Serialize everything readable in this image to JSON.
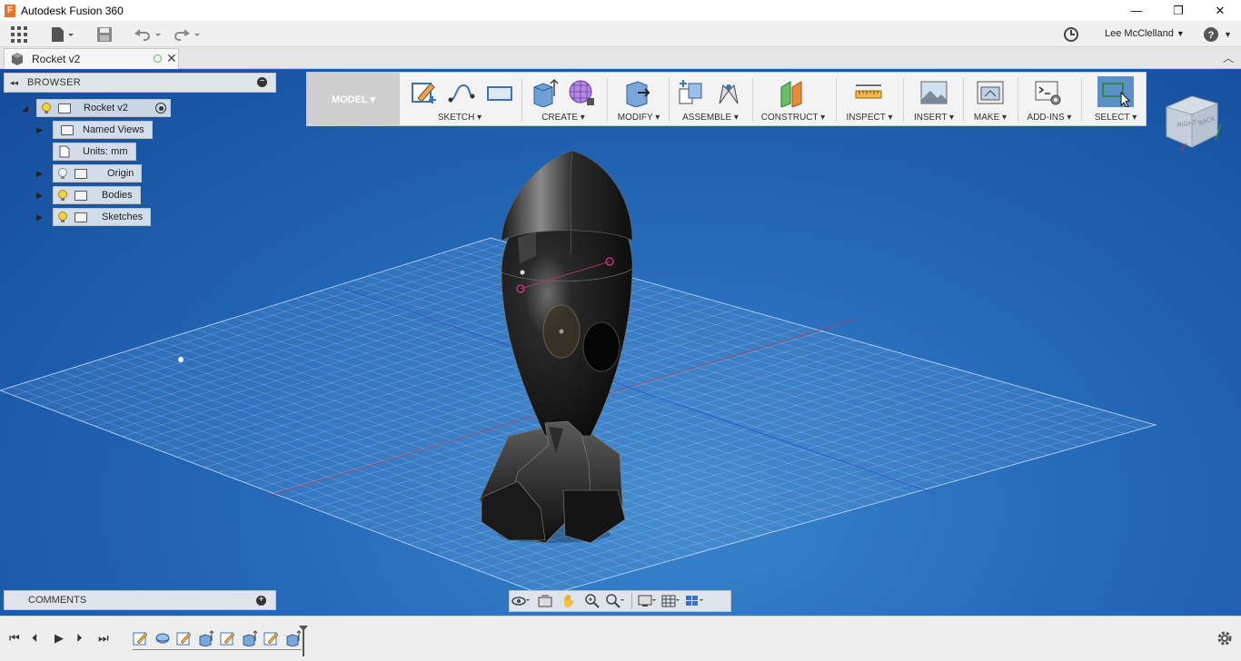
{
  "window": {
    "title": "Autodesk Fusion 360",
    "logo_letter": "F",
    "minimize_glyph": "—",
    "maximize_glyph": "❐",
    "close_glyph": "✕"
  },
  "appbar": {
    "user_name": "Lee McClelland",
    "user_caret": "▼",
    "help_caret": "▼"
  },
  "document_tab": {
    "name": "Rocket v2",
    "close_glyph": "✕"
  },
  "browser": {
    "title": "BROWSER",
    "root": "Rocket v2",
    "items": [
      {
        "label": "Named Views"
      },
      {
        "label": "Units: mm"
      },
      {
        "label": "Origin"
      },
      {
        "label": "Bodies"
      },
      {
        "label": "Sketches"
      }
    ]
  },
  "toolbar": {
    "workspace": "MODEL ▾",
    "groups": [
      {
        "label": "SKETCH ▾"
      },
      {
        "label": "CREATE ▾"
      },
      {
        "label": "MODIFY ▾"
      },
      {
        "label": "ASSEMBLE ▾"
      },
      {
        "label": "CONSTRUCT ▾"
      },
      {
        "label": "INSPECT ▾"
      },
      {
        "label": "INSERT ▾"
      },
      {
        "label": "MAKE ▾"
      },
      {
        "label": "ADD-INS ▾"
      },
      {
        "label": "SELECT ▾"
      }
    ]
  },
  "viewcube": {
    "face_right": "RIGHT",
    "face_back": "BACK"
  },
  "comments": {
    "title": "COMMENTS"
  },
  "timeline": {
    "controls": [
      "⏮",
      "⏴",
      "▶",
      "⏵",
      "⏭"
    ]
  },
  "colors": {
    "viewport_top": "#154c9c",
    "viewport_mid": "#2468b8",
    "toolbar_bg": "#f3f3f3",
    "accent_select": "#5b8fc8"
  }
}
